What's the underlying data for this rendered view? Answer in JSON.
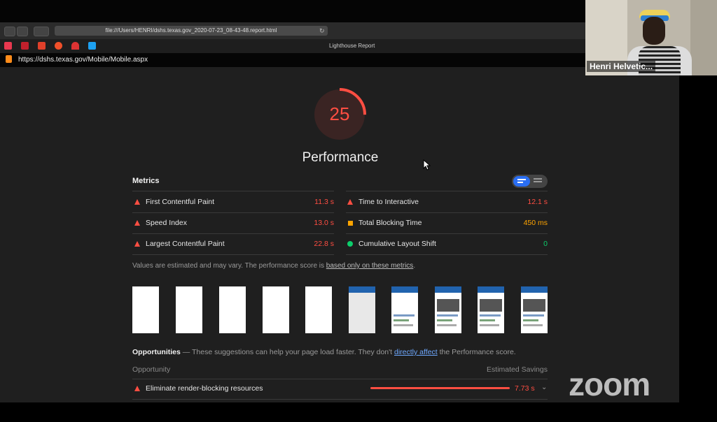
{
  "browser": {
    "file_url": "file:///Users/HENRI/dshs.texas.gov_2020-07-23_08-43-48.report.html",
    "tab_title": "Lighthouse Report",
    "report_url": "https://dshs.texas.gov/Mobile/Mobile.aspx",
    "favicon_colors": [
      "#e8384f",
      "#e8384f",
      "#e8384f",
      "#e8384f",
      "#e8384f",
      "#1da1f2"
    ]
  },
  "report": {
    "score": "25",
    "score_value": 25,
    "category": "Performance",
    "metrics_header": "Metrics",
    "metrics_left": [
      {
        "label": "First Contentful Paint",
        "value": "11.3 s",
        "status": "fail"
      },
      {
        "label": "Speed Index",
        "value": "13.0 s",
        "status": "fail"
      },
      {
        "label": "Largest Contentful Paint",
        "value": "22.8 s",
        "status": "fail"
      }
    ],
    "metrics_right": [
      {
        "label": "Time to Interactive",
        "value": "12.1 s",
        "status": "fail"
      },
      {
        "label": "Total Blocking Time",
        "value": "450 ms",
        "status": "average"
      },
      {
        "label": "Cumulative Layout Shift",
        "value": "0",
        "status": "pass"
      }
    ],
    "note_prefix": "Values are estimated and may vary. The performance score is ",
    "note_link": "based only on these metrics",
    "note_suffix": ".",
    "opportunities_title": "Opportunities",
    "opportunities_desc_prefix": " — These suggestions can help your page load faster. They don't ",
    "opportunities_link": "directly affect",
    "opportunities_desc_suffix": " the Performance score.",
    "col_opportunity": "Opportunity",
    "col_savings": "Estimated Savings",
    "opportunity_item": {
      "label": "Eliminate render-blocking resources",
      "value": "7.73 s"
    },
    "colors": {
      "fail": "#ff4e42",
      "average": "#ffa400",
      "pass": "#0cce6b",
      "accent": "#2a6ef3"
    }
  },
  "zoom": {
    "participant_name": "Henri Helvetic...",
    "logo": "zoom"
  }
}
